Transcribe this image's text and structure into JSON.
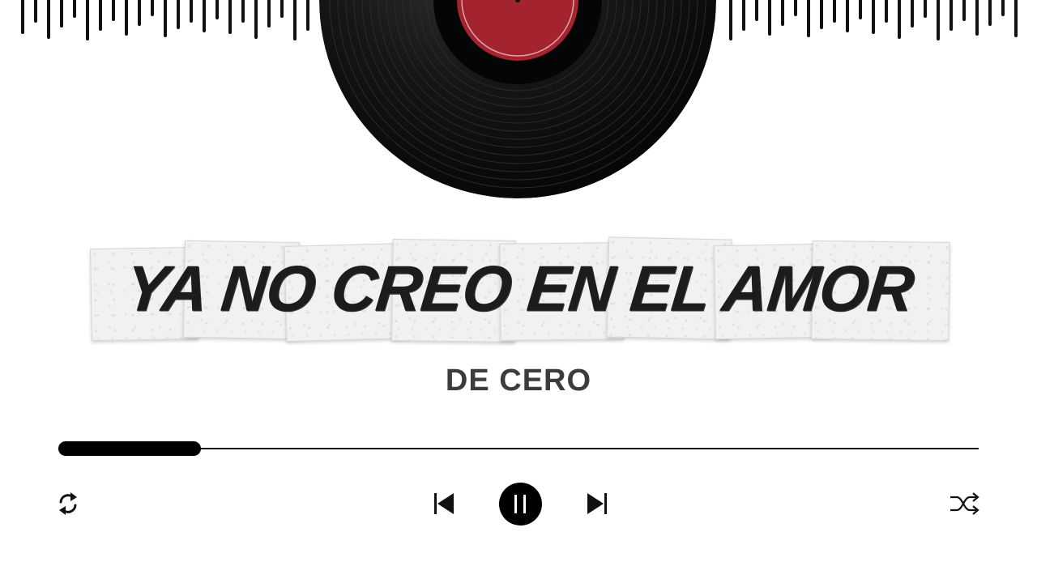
{
  "player": {
    "song_title": "YA NO CREO EN EL AMOR",
    "artist": "DE CERO",
    "progress_fraction": 0.155,
    "is_playing": true
  },
  "controls": {
    "repeat_icon": "repeat-icon",
    "previous_icon": "skip-previous-icon",
    "pause_icon": "pause-icon",
    "next_icon": "skip-next-icon",
    "shuffle_icon": "shuffle-icon"
  },
  "colors": {
    "background": "#ffffff",
    "record": "#0d0d0d",
    "record_label": "#a3232f",
    "progress": "#000000",
    "title_text": "#1c1c1c",
    "artist_text": "#3c3c3c"
  }
}
